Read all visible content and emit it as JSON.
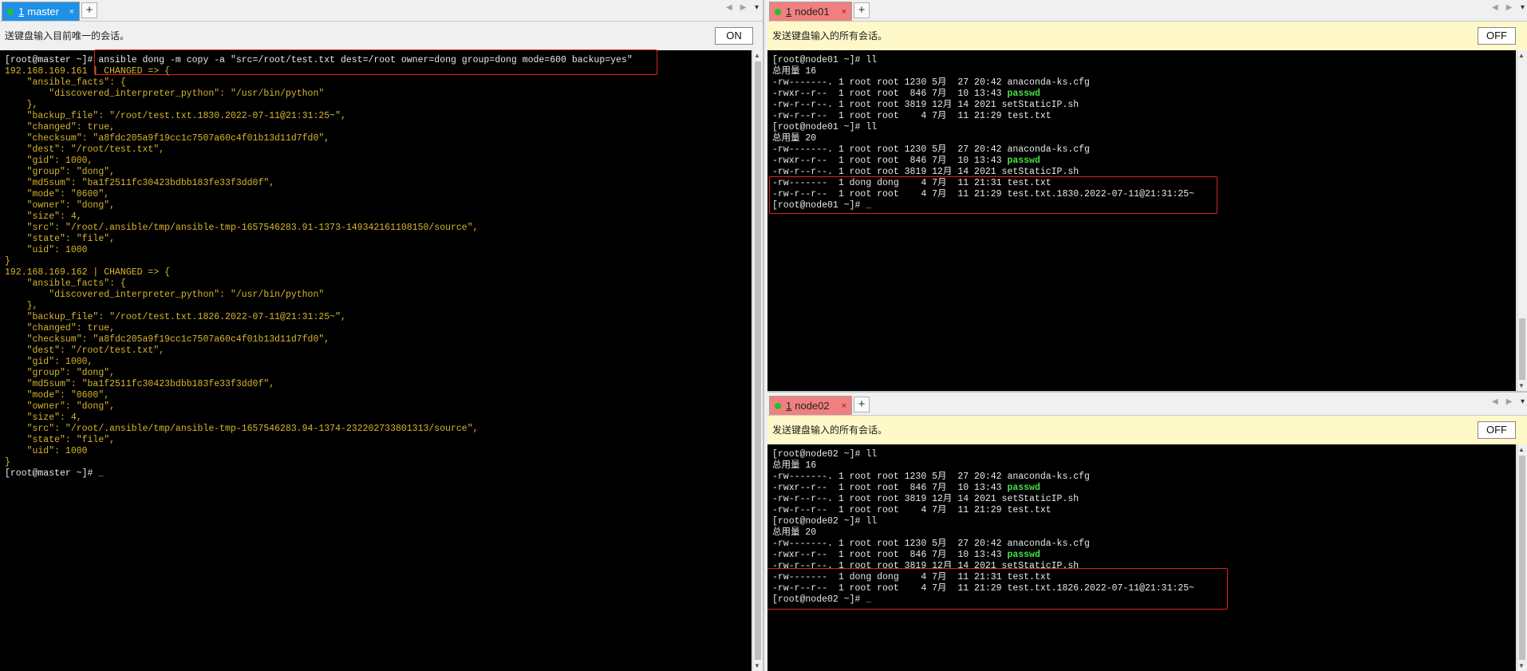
{
  "master": {
    "tab": {
      "num": "1",
      "title": "master",
      "close": "×"
    },
    "bar_text": "送键盘输入目前唯一的会话。",
    "toggle": "ON",
    "lines": [
      {
        "t": "[root@master ~]# ansible dong -m copy -a \"src=/root/test.txt dest=/root owner=dong group=dong mode=600 backup=yes\""
      },
      {
        "t": "192.168.169.161 | CHANGED => {",
        "y": true
      },
      {
        "t": "    \"ansible_facts\": {",
        "y": true
      },
      {
        "t": "        \"discovered_interpreter_python\": \"/usr/bin/python\"",
        "y": true
      },
      {
        "t": "    },",
        "y": true
      },
      {
        "t": "    \"backup_file\": \"/root/test.txt.1830.2022-07-11@21:31:25~\",",
        "y": true
      },
      {
        "t": "    \"changed\": true,",
        "y": true
      },
      {
        "t": "    \"checksum\": \"a8fdc205a9f19cc1c7507a60c4f01b13d11d7fd0\",",
        "y": true
      },
      {
        "t": "    \"dest\": \"/root/test.txt\",",
        "y": true
      },
      {
        "t": "    \"gid\": 1000,",
        "y": true
      },
      {
        "t": "    \"group\": \"dong\",",
        "y": true
      },
      {
        "t": "    \"md5sum\": \"ba1f2511fc30423bdbb183fe33f3dd0f\",",
        "y": true
      },
      {
        "t": "    \"mode\": \"0600\",",
        "y": true
      },
      {
        "t": "    \"owner\": \"dong\",",
        "y": true
      },
      {
        "t": "    \"size\": 4,",
        "y": true
      },
      {
        "t": "    \"src\": \"/root/.ansible/tmp/ansible-tmp-1657546283.91-1373-149342161108150/source\",",
        "y": true
      },
      {
        "t": "    \"state\": \"file\",",
        "y": true
      },
      {
        "t": "    \"uid\": 1000",
        "y": true
      },
      {
        "t": "}",
        "y": true
      },
      {
        "t": "192.168.169.162 | CHANGED => {",
        "y": true
      },
      {
        "t": "    \"ansible_facts\": {",
        "y": true
      },
      {
        "t": "        \"discovered_interpreter_python\": \"/usr/bin/python\"",
        "y": true
      },
      {
        "t": "    },",
        "y": true
      },
      {
        "t": "    \"backup_file\": \"/root/test.txt.1826.2022-07-11@21:31:25~\",",
        "y": true
      },
      {
        "t": "    \"changed\": true,",
        "y": true
      },
      {
        "t": "    \"checksum\": \"a8fdc205a9f19cc1c7507a60c4f01b13d11d7fd0\",",
        "y": true
      },
      {
        "t": "    \"dest\": \"/root/test.txt\",",
        "y": true
      },
      {
        "t": "    \"gid\": 1000,",
        "y": true
      },
      {
        "t": "    \"group\": \"dong\",",
        "y": true
      },
      {
        "t": "    \"md5sum\": \"ba1f2511fc30423bdbb183fe33f3dd0f\",",
        "y": true
      },
      {
        "t": "    \"mode\": \"0600\",",
        "y": true
      },
      {
        "t": "    \"owner\": \"dong\",",
        "y": true
      },
      {
        "t": "    \"size\": 4,",
        "y": true
      },
      {
        "t": "    \"src\": \"/root/.ansible/tmp/ansible-tmp-1657546283.94-1374-232202733801313/source\",",
        "y": true
      },
      {
        "t": "    \"state\": \"file\",",
        "y": true
      },
      {
        "t": "    \"uid\": 1000",
        "y": true
      },
      {
        "t": "}",
        "y": true
      },
      {
        "t": "[root@master ~]# ",
        "cursor": true
      }
    ]
  },
  "node01": {
    "tab": {
      "num": "1",
      "title": "node01",
      "close": "×"
    },
    "bar_text": "发送键盘输入的所有会话。",
    "toggle": "OFF",
    "lines": [
      {
        "t": "[root@node01 ~]# ll"
      },
      {
        "t": "总用量 16"
      },
      {
        "t": "-rw-------. 1 root root 1230 5月  27 20:42 anaconda-ks.cfg"
      },
      {
        "t": "-rwxr--r--  1 root root  846 7月  10 13:43 ",
        "g": "passwd"
      },
      {
        "t": "-rw-r--r--. 1 root root 3819 12月 14 2021 setStaticIP.sh"
      },
      {
        "t": "-rw-r--r--  1 root root    4 7月  11 21:29 test.txt"
      },
      {
        "t": "[root@node01 ~]# ll"
      },
      {
        "t": "总用量 20"
      },
      {
        "t": "-rw-------. 1 root root 1230 5月  27 20:42 anaconda-ks.cfg"
      },
      {
        "t": "-rwxr--r--  1 root root  846 7月  10 13:43 ",
        "g": "passwd"
      },
      {
        "t": "-rw-r--r--. 1 root root 3819 12月 14 2021 setStaticIP.sh"
      },
      {
        "t": "-rw-------  1 dong dong    4 7月  11 21:31 test.txt"
      },
      {
        "t": "-rw-r--r--  1 root root    4 7月  11 21:29 test.txt.1830.2022-07-11@21:31:25~"
      },
      {
        "t": "[root@node01 ~]# ",
        "cursor": true
      }
    ]
  },
  "node02": {
    "tab": {
      "num": "1",
      "title": "node02",
      "close": "×"
    },
    "bar_text": "发送键盘输入的所有会话。",
    "toggle": "OFF",
    "lines": [
      {
        "t": "[root@node02 ~]# ll"
      },
      {
        "t": "总用量 16"
      },
      {
        "t": "-rw-------. 1 root root 1230 5月  27 20:42 anaconda-ks.cfg"
      },
      {
        "t": "-rwxr--r--  1 root root  846 7月  10 13:43 ",
        "g": "passwd"
      },
      {
        "t": "-rw-r--r--. 1 root root 3819 12月 14 2021 setStaticIP.sh"
      },
      {
        "t": "-rw-r--r--  1 root root    4 7月  11 21:29 test.txt"
      },
      {
        "t": "[root@node02 ~]# ll"
      },
      {
        "t": "总用量 20"
      },
      {
        "t": "-rw-------. 1 root root 1230 5月  27 20:42 anaconda-ks.cfg"
      },
      {
        "t": "-rwxr--r--  1 root root  846 7月  10 13:43 ",
        "g": "passwd"
      },
      {
        "t": "-rw-r--r--. 1 root root 3819 12月 14 2021 setStaticIP.sh"
      },
      {
        "t": "-rw-------  1 dong dong    4 7月  11 21:31 test.txt"
      },
      {
        "t": "-rw-r--r--  1 root root    4 7月  11 21:29 test.txt.1826.2022-07-11@21:31:25~"
      },
      {
        "t": "[root@node02 ~]# ",
        "cursor": true
      }
    ]
  },
  "ui": {
    "add_tab": "+",
    "nav_arrows": "◀▶",
    "menu_arrow": "▾",
    "cursor": "_",
    "scroll_up": "▲",
    "scroll_down": "▼",
    "colors": {
      "json_output": "#d7b52d",
      "executable": "#48e048",
      "highlight_box": "#e02020",
      "active_tab": "#1e90e6",
      "broadcast_tab": "#f08080"
    }
  }
}
